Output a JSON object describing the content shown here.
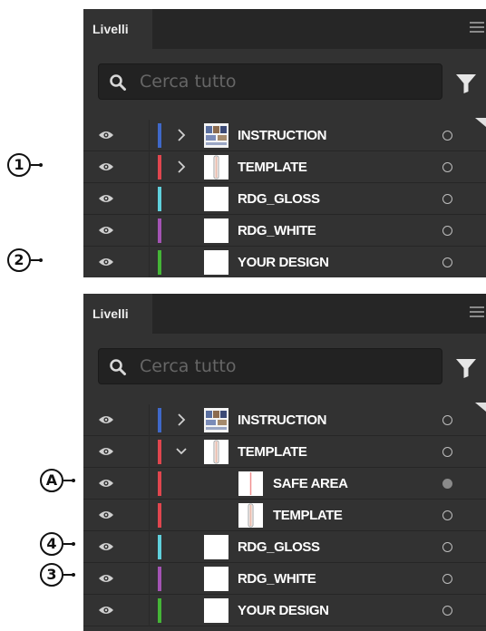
{
  "colors": {
    "panel_bg": "#323232",
    "tabbar_bg": "#262626",
    "blue": "#3f68c8",
    "red": "#e0464e",
    "cyan": "#5fd0dc",
    "purple": "#a453b4",
    "green": "#45b537"
  },
  "panels": [
    {
      "tab_label": "Livelli",
      "search_placeholder": "Cerca tutto",
      "layers": [
        {
          "name": "INSTRUCTION",
          "color": "#3f68c8",
          "chevron": "chevron-right-icon",
          "thumb": "instruction",
          "level": 0,
          "target": "empty"
        },
        {
          "name": "TEMPLATE",
          "color": "#e0464e",
          "chevron": "chevron-right-icon",
          "thumb": "template",
          "level": 0,
          "target": "empty"
        },
        {
          "name": "RDG_GLOSS",
          "color": "#5fd0dc",
          "chevron": "",
          "thumb": "blank",
          "level": 0,
          "target": "empty"
        },
        {
          "name": "RDG_WHITE",
          "color": "#a453b4",
          "chevron": "",
          "thumb": "blank",
          "level": 0,
          "target": "empty"
        },
        {
          "name": "YOUR DESIGN",
          "color": "#45b537",
          "chevron": "",
          "thumb": "blank",
          "level": 0,
          "target": "empty"
        }
      ]
    },
    {
      "tab_label": "Livelli",
      "search_placeholder": "Cerca tutto",
      "layers": [
        {
          "name": "INSTRUCTION",
          "color": "#3f68c8",
          "chevron": "chevron-right-icon",
          "thumb": "instruction",
          "level": 0,
          "target": "empty"
        },
        {
          "name": "TEMPLATE",
          "color": "#e0464e",
          "chevron": "chevron-down-icon",
          "thumb": "template",
          "level": 0,
          "target": "empty"
        },
        {
          "name": "SAFE AREA",
          "color": "#e0464e",
          "chevron": "",
          "thumb": "safearea",
          "level": 1,
          "target": "filled"
        },
        {
          "name": "TEMPLATE",
          "color": "#e0464e",
          "chevron": "",
          "thumb": "template",
          "level": 1,
          "target": "empty"
        },
        {
          "name": "RDG_GLOSS",
          "color": "#5fd0dc",
          "chevron": "",
          "thumb": "blank",
          "level": 0,
          "target": "empty"
        },
        {
          "name": "RDG_WHITE",
          "color": "#a453b4",
          "chevron": "",
          "thumb": "blank",
          "level": 0,
          "target": "empty"
        },
        {
          "name": "YOUR DESIGN",
          "color": "#45b537",
          "chevron": "",
          "thumb": "blank",
          "level": 0,
          "target": "empty"
        }
      ]
    }
  ],
  "callouts": [
    {
      "label": "1",
      "points_to": "TEMPLATE (panel 1)"
    },
    {
      "label": "2",
      "points_to": "YOUR DESIGN (panel 1)"
    },
    {
      "label": "A",
      "points_to": "SAFE AREA (panel 2)"
    },
    {
      "label": "4",
      "points_to": "RDG_GLOSS (panel 2)"
    },
    {
      "label": "3",
      "points_to": "RDG_WHITE (panel 2)"
    }
  ]
}
